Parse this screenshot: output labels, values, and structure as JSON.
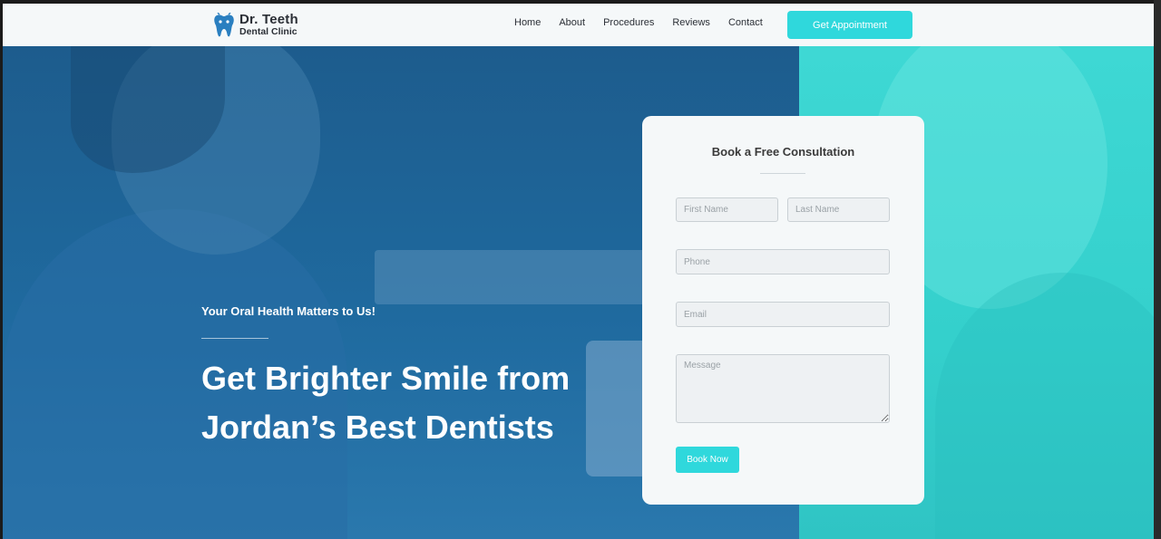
{
  "header": {
    "logo": {
      "title": "Dr. Teeth",
      "subtitle": "Dental Clinic",
      "icon": "tooth-icon"
    },
    "nav": [
      {
        "label": "Home"
      },
      {
        "label": "About"
      },
      {
        "label": "Procedures"
      },
      {
        "label": "Reviews"
      },
      {
        "label": "Contact"
      }
    ],
    "cta_label": "Get Appointment"
  },
  "hero": {
    "tagline": "Your Oral Health Matters to Us!",
    "headline": "Get Brighter Smile from Jordan’s Best Dentists"
  },
  "form": {
    "title": "Book a Free Consultation",
    "first_name_placeholder": "First Name",
    "last_name_placeholder": "Last Name",
    "phone_placeholder": "Phone",
    "email_placeholder": "Email",
    "message_placeholder": "Message",
    "submit_label": "Book Now"
  },
  "colors": {
    "accent": "#2fd8dc",
    "hero_blue": "#1f6a9f",
    "hero_teal": "#3ed8d4",
    "text_dark": "#2b2f36"
  }
}
